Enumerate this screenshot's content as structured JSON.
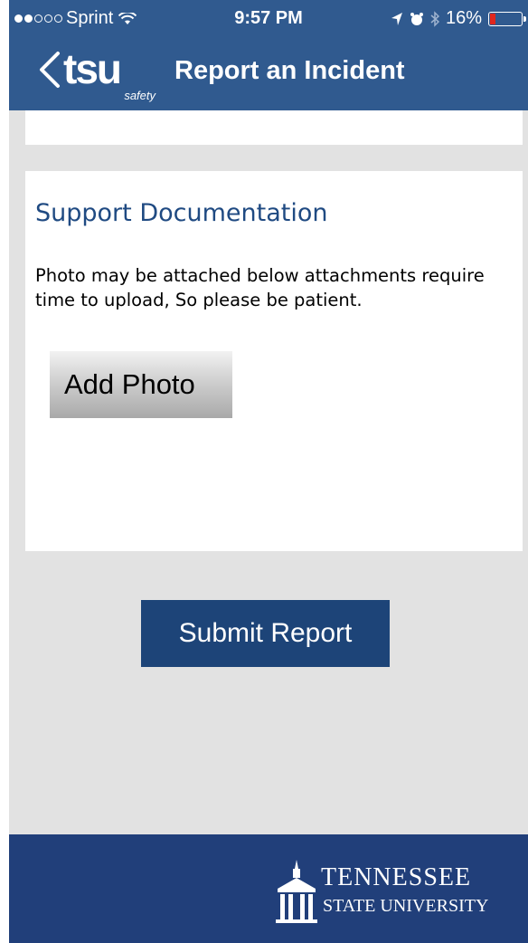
{
  "status_bar": {
    "signal_bars": 2,
    "carrier": "Sprint",
    "time": "9:57 PM",
    "battery": "16%",
    "battery_level": 0.16,
    "icons": [
      "signal-dots-icon",
      "wifi-icon",
      "location-arrow-icon",
      "alarm-icon",
      "bluetooth-icon",
      "battery-icon"
    ]
  },
  "nav": {
    "back_icon": "chevron-left-icon",
    "logo_text": "tsu",
    "logo_subtext": "safety",
    "title": "Report an Incident"
  },
  "support": {
    "title": "Support Documentation",
    "description": "Photo may be attached below attachments require time to upload, So please be patient.",
    "add_photo_label": "Add Photo"
  },
  "submit_label": "Submit Report",
  "footer": {
    "logo_icon": "tsu-building-icon",
    "line1": "TENNESSEE",
    "line2": "STATE UNIVERSITY"
  },
  "colors": {
    "header_blue": "#305a8f",
    "title_blue": "#1f4a82",
    "submit_blue": "#1d4478",
    "footer_blue": "#213f7a",
    "background_gray": "#e2e2e2",
    "battery_red": "#e0261d"
  }
}
